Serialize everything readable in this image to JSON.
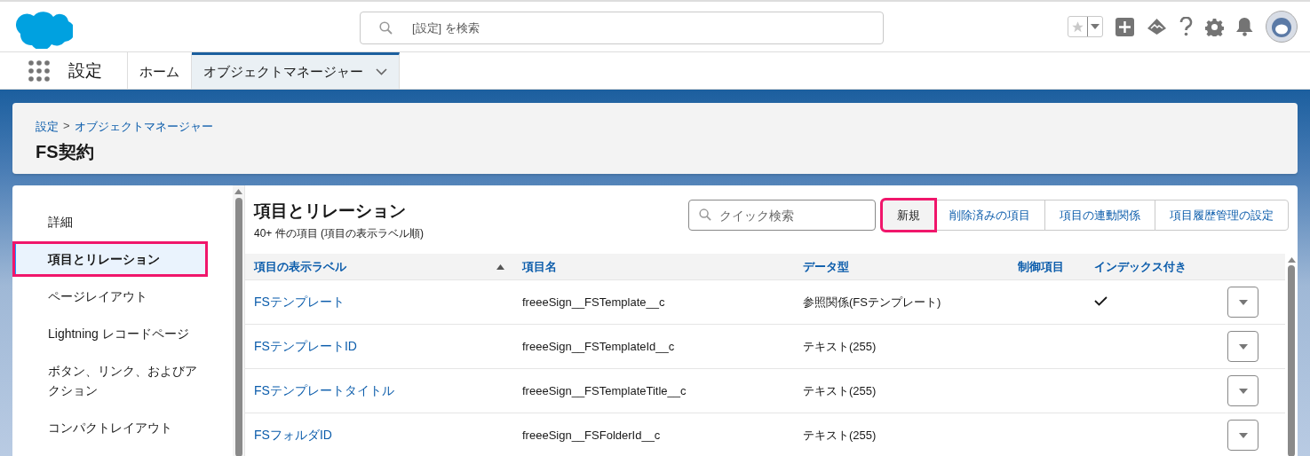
{
  "header": {
    "search_placeholder": "[設定] を検索"
  },
  "nav": {
    "app_name": "設定",
    "tabs": [
      {
        "label": "ホーム",
        "selected": false,
        "has_menu": false
      },
      {
        "label": "オブジェクトマネージャー",
        "selected": true,
        "has_menu": true
      }
    ]
  },
  "page_header": {
    "breadcrumb": [
      "設定",
      "オブジェクトマネージャー"
    ],
    "separator": ">",
    "title": "FS契約"
  },
  "sidebar": {
    "items": [
      {
        "label": "詳細",
        "selected": false,
        "highlighted": false
      },
      {
        "label": "項目とリレーション",
        "selected": true,
        "highlighted": true
      },
      {
        "label": "ページレイアウト",
        "selected": false,
        "highlighted": false
      },
      {
        "label": "Lightning レコードページ",
        "selected": false,
        "highlighted": false
      },
      {
        "label": "ボタン、リンク、およびアクション",
        "selected": false,
        "highlighted": false
      },
      {
        "label": "コンパクトレイアウト",
        "selected": false,
        "highlighted": false
      }
    ]
  },
  "section": {
    "title": "項目とリレーション",
    "subtitle": "40+ 件の項目 (項目の表示ラベル順)",
    "search_placeholder": "クイック検索",
    "buttons": [
      {
        "label": "新規",
        "highlighted": true
      },
      {
        "label": "削除済みの項目",
        "highlighted": false
      },
      {
        "label": "項目の連動関係",
        "highlighted": false
      },
      {
        "label": "項目履歴管理の設定",
        "highlighted": false
      }
    ]
  },
  "table": {
    "columns": [
      {
        "label": "項目の表示ラベル",
        "sorted": true
      },
      {
        "label": "項目名",
        "sorted": false
      },
      {
        "label": "データ型",
        "sorted": false
      },
      {
        "label": "制御項目",
        "sorted": false
      },
      {
        "label": "インデックス付き",
        "sorted": false
      }
    ],
    "rows": [
      {
        "label": "FSテンプレート",
        "name": "freeeSign__FSTemplate__c",
        "type": "参照関係(FSテンプレート)",
        "indexed": true
      },
      {
        "label": "FSテンプレートID",
        "name": "freeeSign__FSTemplateId__c",
        "type": "テキスト(255)",
        "indexed": false
      },
      {
        "label": "FSテンプレートタイトル",
        "name": "freeeSign__FSTemplateTitle__c",
        "type": "テキスト(255)",
        "indexed": false
      },
      {
        "label": "FSフォルダID",
        "name": "freeeSign__FSFolderId__c",
        "type": "テキスト(255)",
        "indexed": false
      }
    ]
  }
}
